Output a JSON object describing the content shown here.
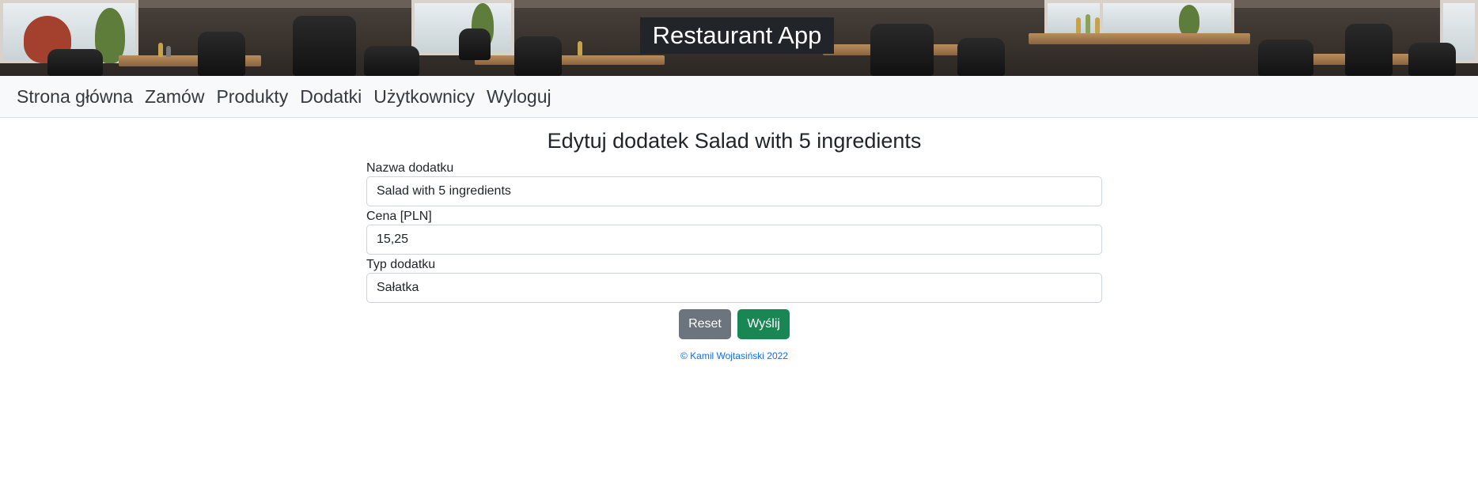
{
  "header": {
    "app_title": "Restaurant App"
  },
  "nav": {
    "items": [
      {
        "label": "Strona główna"
      },
      {
        "label": "Zamów"
      },
      {
        "label": "Produkty"
      },
      {
        "label": "Dodatki"
      },
      {
        "label": "Użytkownicy"
      },
      {
        "label": "Wyloguj"
      }
    ]
  },
  "form": {
    "title": "Edytuj dodatek Salad with 5 ingredients",
    "name_label": "Nazwa dodatku",
    "name_value": "Salad with 5 ingredients",
    "price_label": "Cena [PLN]",
    "price_value": "15,25",
    "type_label": "Typ dodatku",
    "type_value": "Sałatka",
    "reset_label": "Reset",
    "submit_label": "Wyślij"
  },
  "footer": {
    "text": "© Kamil Wojtasiński 2022"
  },
  "colors": {
    "navbar_bg": "#f8f9fa",
    "title_box_bg": "#212529",
    "reset_button": "#6c757d",
    "submit_button": "#198754",
    "footer_link": "#0d6efd"
  }
}
